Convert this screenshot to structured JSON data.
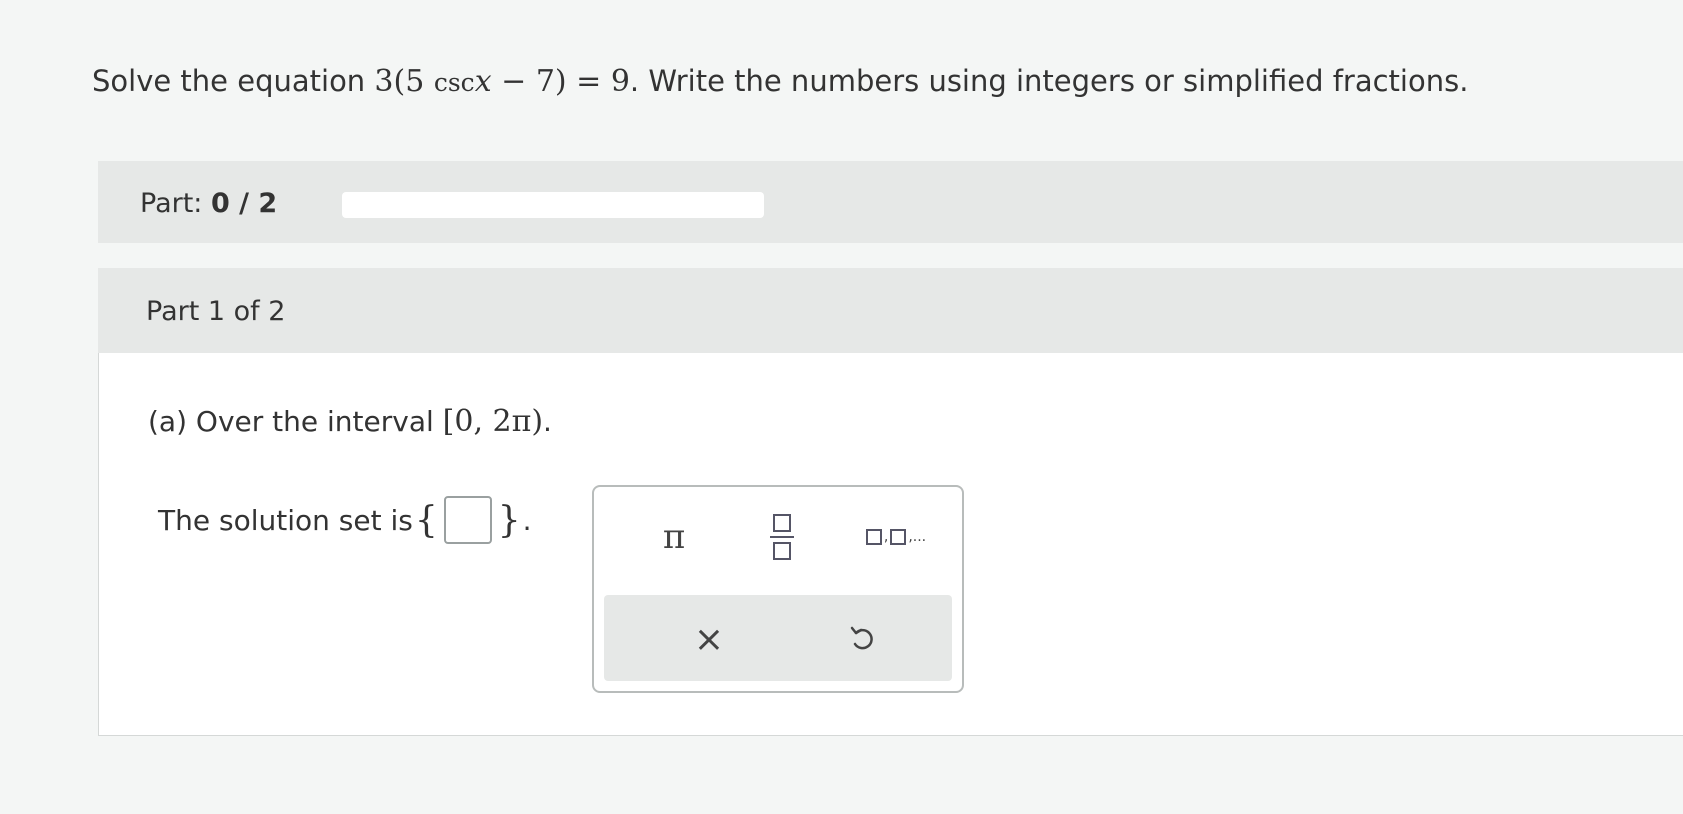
{
  "question": {
    "prefix": "Solve the equation ",
    "eq_a": "3",
    "eq_b": "(5 ",
    "eq_fn": "csc",
    "eq_var": "x",
    "eq_c": " − 7) = 9",
    "suffix": ". Write the numbers using integers or simplified fractions."
  },
  "progress": {
    "label": "Part: ",
    "value": "0 / 2",
    "completed_fraction": 0
  },
  "part": {
    "title": "Part 1 of 2",
    "prompt_prefix": "(a) Over the interval ",
    "interval": "[0, 2π)",
    "prompt_suffix": ".",
    "solution_label": "The solution set is ",
    "brace_open": "{",
    "brace_close": "}",
    "solution_suffix": ".",
    "answer_value": ""
  },
  "palette": {
    "pi_label": "π",
    "fraction_icon": "fraction-icon",
    "list_icon": "list-icon",
    "list_ellipsis": ",...",
    "clear_label": "×",
    "undo_icon": "undo-icon"
  },
  "colors": {
    "text": "#333333",
    "panel_gray": "#e6e8e7",
    "border": "#b8bcbb"
  }
}
